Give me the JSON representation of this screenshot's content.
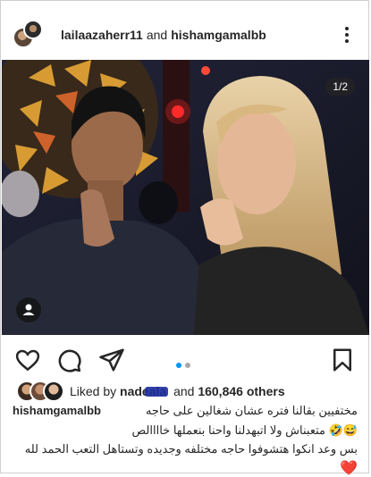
{
  "header": {
    "user1": "lailaazaherr11",
    "and_word": "and",
    "user2": "hishamgamalbb"
  },
  "photo": {
    "counter": "1/2"
  },
  "icons": {
    "like": "heart-outline-icon",
    "comment": "comment-bubble-icon",
    "share": "paper-plane-icon",
    "save": "bookmark-icon",
    "more": "more-dots-icon",
    "tag": "person-tag-icon"
  },
  "carousel": {
    "pages": 2,
    "current": 1
  },
  "likes": {
    "prefix": "Liked by",
    "liker_visible": "nadeala",
    "middle": "and",
    "count": "160,846 others"
  },
  "caption": {
    "username": "hishamgamalbb",
    "line1": "مختفيين بقالنا فتره عشان شغالين على حاجه",
    "line2": "😅🤣 متعبناش ولا اتبهدلنا واحنا بنعملها خاااالص",
    "line3": "بس وعد انكوا هتشوفوا حاجه مختلفه وجديده وتستاهل التعب الحمد لله",
    "heart": "❤️"
  },
  "colors": {
    "accent_blue": "#0095f6",
    "text": "#262626",
    "heart_red": "#ed4956"
  }
}
